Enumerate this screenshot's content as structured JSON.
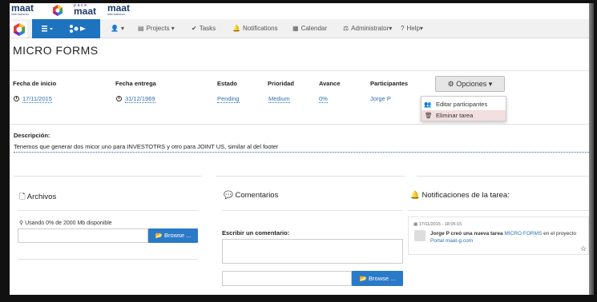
{
  "brand": {
    "logo1_text": "maat",
    "logo1_sub": "international",
    "logo2_top": "p a c e",
    "logo2_text": "maat",
    "logo3_text": "maat",
    "logo3_sub": "international"
  },
  "nav": {
    "items": [
      {
        "icon": "user-icon",
        "label": ""
      },
      {
        "icon": "clipboard-icon",
        "label": "Projects"
      },
      {
        "icon": "check-circle-icon",
        "label": "Tasks"
      },
      {
        "icon": "bell-icon",
        "label": "Notifications"
      },
      {
        "icon": "calendar-icon",
        "label": "Calendar"
      },
      {
        "icon": "scale-icon",
        "label": "Administrator"
      },
      {
        "icon": "question-icon",
        "label": "Help"
      }
    ],
    "accent": "#1e73be"
  },
  "task": {
    "title": "MICRO FORMS",
    "fields": {
      "fecha_inicio_label": "Fecha de inicio",
      "fecha_inicio_value": "17/11/2015",
      "fecha_entrega_label": "Fecha entrega",
      "fecha_entrega_value": "31/12/1969",
      "estado_label": "Estado",
      "estado_value": "Pending",
      "prioridad_label": "Prioridad",
      "prioridad_value": "Medium",
      "avance_label": "Avance",
      "avance_value": "0%",
      "participantes_label": "Participantes",
      "participantes_value": "Jorge P"
    },
    "options_button": "Opciones",
    "dropdown": {
      "edit": "Editar participantes",
      "delete": "Eliminar tarea"
    },
    "description_label": "Descripción:",
    "description_text": "Tenemos que generar dos micor uno para  INVESTOTRS y otro para JOINT US, similar al del footer"
  },
  "archivos": {
    "title": "Archivos",
    "usage": "Usando 0% de 2000 Mb disponible",
    "browse": "Browse ..."
  },
  "comentarios": {
    "title": "Comentarios",
    "write_label": "Escribir un comentario:",
    "browse": "Browse ..."
  },
  "notificaciones": {
    "title": "Notificaciones de la tarea:",
    "timestamp": "17/11/2015 - 18:05:15",
    "text_before": "Jorge P creó una nueva tarea ",
    "task_link": "MICRO FORMS",
    "text_after": " en el proyecto",
    "project_link": "Portal maat-g.com"
  }
}
